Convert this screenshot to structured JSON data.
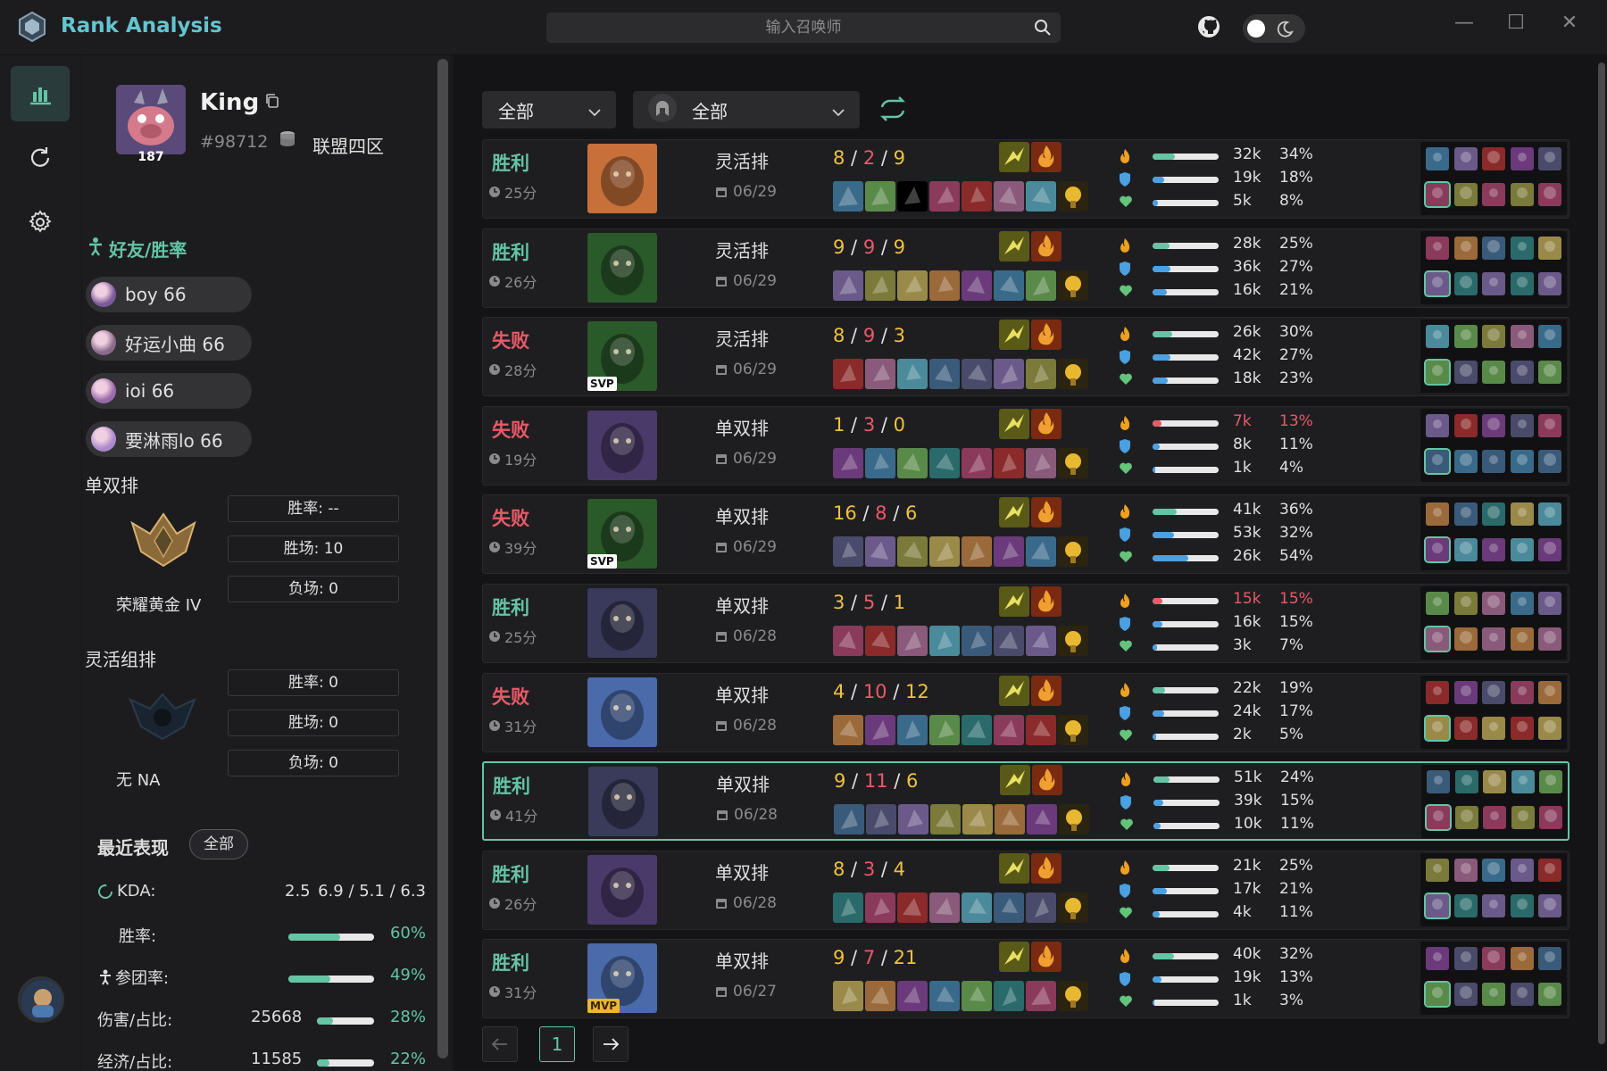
{
  "app": {
    "title": "Rank Analysis"
  },
  "search": {
    "placeholder": "输入召唤师"
  },
  "profile": {
    "name": "King",
    "tag": "#98712",
    "server": "联盟四区",
    "level": "187"
  },
  "friends": {
    "title": "好友/胜率",
    "items": [
      {
        "name": "boy 66",
        "color": "#7a5a9a"
      },
      {
        "name": "好运小曲 66",
        "color": "#8a6a8a"
      },
      {
        "name": "ioi 66",
        "color": "#9a6aaa"
      },
      {
        "name": "要淋雨lo 66",
        "color": "#aa8acc"
      }
    ]
  },
  "ranks": [
    {
      "title": "单双排",
      "winrate": "胜率: --",
      "wins": "胜场: 10",
      "losses": "负场: 0",
      "tier": "荣耀黄金 IV"
    },
    {
      "title": "灵活组排",
      "winrate": "胜率: 0",
      "wins": "胜场: 0",
      "losses": "负场: 0",
      "tier": "无 NA"
    }
  ],
  "recent": {
    "title": "最近表现",
    "filter": "全部",
    "kda_label": "KDA:",
    "kda_value": "2.5",
    "kda_detail": "6.9 / 5.1 / 6.3",
    "winrate_label": "胜率:",
    "winrate_pct": "60%",
    "winrate_value": 0.6,
    "teamfight_label": "参团率:",
    "teamfight_pct": "49%",
    "teamfight_value": 0.49,
    "damage_label": "伤害/占比:",
    "damage_value": "25668",
    "damage_pct": "28%",
    "damage_ratio": 0.28,
    "gold_label": "经济/占比:",
    "gold_value": "11585",
    "gold_pct": "22%",
    "gold_ratio": 0.22
  },
  "filters": {
    "mode": "全部",
    "champion": "全部"
  },
  "matches": [
    {
      "result": "胜利",
      "win": true,
      "duration": "25分",
      "queue": "灵活排",
      "date": "06/29",
      "k": "8",
      "d": "2",
      "a": "9",
      "badge": "",
      "champ": "#c8703a",
      "dmg": "32k",
      "dmg_pct": "34%",
      "dmg_r": 0.34,
      "tank": "19k",
      "tank_pct": "18%",
      "tank_r": 0.18,
      "heal": "5k",
      "heal_pct": "8%",
      "heal_r": 0.08,
      "selected": false
    },
    {
      "result": "胜利",
      "win": true,
      "duration": "26分",
      "queue": "灵活排",
      "date": "06/29",
      "k": "9",
      "d": "9",
      "a": "9",
      "badge": "",
      "champ": "#2a5a2a",
      "dmg": "28k",
      "dmg_pct": "25%",
      "dmg_r": 0.25,
      "tank": "36k",
      "tank_pct": "27%",
      "tank_r": 0.27,
      "heal": "16k",
      "heal_pct": "21%",
      "heal_r": 0.21,
      "selected": false
    },
    {
      "result": "失败",
      "win": false,
      "duration": "28分",
      "queue": "灵活排",
      "date": "06/29",
      "k": "8",
      "d": "9",
      "a": "3",
      "badge": "SVP",
      "champ": "#2a5a2a",
      "dmg": "26k",
      "dmg_pct": "30%",
      "dmg_r": 0.3,
      "tank": "42k",
      "tank_pct": "27%",
      "tank_r": 0.27,
      "heal": "18k",
      "heal_pct": "23%",
      "heal_r": 0.23,
      "selected": false
    },
    {
      "result": "失败",
      "win": false,
      "duration": "19分",
      "queue": "单双排",
      "date": "06/29",
      "k": "1",
      "d": "3",
      "a": "0",
      "badge": "",
      "champ": "#4a3a6a",
      "dmg": "7k",
      "dmg_pct": "13%",
      "dmg_r": 0.13,
      "dmg_low": true,
      "tank": "8k",
      "tank_pct": "11%",
      "tank_r": 0.11,
      "heal": "1k",
      "heal_pct": "4%",
      "heal_r": 0.04,
      "selected": false
    },
    {
      "result": "失败",
      "win": false,
      "duration": "39分",
      "queue": "单双排",
      "date": "06/29",
      "k": "16",
      "d": "8",
      "a": "6",
      "badge": "SVP",
      "champ": "#2a5a2a",
      "dmg": "41k",
      "dmg_pct": "36%",
      "dmg_r": 0.36,
      "tank": "53k",
      "tank_pct": "32%",
      "tank_r": 0.32,
      "heal": "26k",
      "heal_pct": "54%",
      "heal_r": 0.54,
      "selected": false
    },
    {
      "result": "胜利",
      "win": true,
      "duration": "25分",
      "queue": "单双排",
      "date": "06/28",
      "k": "3",
      "d": "5",
      "a": "1",
      "badge": "",
      "champ": "#3a3a5a",
      "dmg": "15k",
      "dmg_pct": "15%",
      "dmg_r": 0.15,
      "dmg_low": true,
      "tank": "16k",
      "tank_pct": "15%",
      "tank_r": 0.15,
      "heal": "3k",
      "heal_pct": "7%",
      "heal_r": 0.07,
      "selected": false
    },
    {
      "result": "失败",
      "win": false,
      "duration": "31分",
      "queue": "单双排",
      "date": "06/28",
      "k": "4",
      "d": "10",
      "a": "12",
      "badge": "",
      "champ": "#4a6aaa",
      "dmg": "22k",
      "dmg_pct": "19%",
      "dmg_r": 0.19,
      "tank": "24k",
      "tank_pct": "17%",
      "tank_r": 0.17,
      "heal": "2k",
      "heal_pct": "5%",
      "heal_r": 0.05,
      "selected": false
    },
    {
      "result": "胜利",
      "win": true,
      "duration": "41分",
      "queue": "单双排",
      "date": "06/28",
      "k": "9",
      "d": "11",
      "a": "6",
      "badge": "",
      "champ": "#3a3a5a",
      "dmg": "51k",
      "dmg_pct": "24%",
      "dmg_r": 0.24,
      "tank": "39k",
      "tank_pct": "15%",
      "tank_r": 0.15,
      "heal": "10k",
      "heal_pct": "11%",
      "heal_r": 0.11,
      "selected": true
    },
    {
      "result": "胜利",
      "win": true,
      "duration": "26分",
      "queue": "单双排",
      "date": "06/28",
      "k": "8",
      "d": "3",
      "a": "4",
      "badge": "",
      "champ": "#4a3a6a",
      "dmg": "21k",
      "dmg_pct": "25%",
      "dmg_r": 0.25,
      "tank": "17k",
      "tank_pct": "21%",
      "tank_r": 0.21,
      "heal": "4k",
      "heal_pct": "11%",
      "heal_r": 0.11,
      "selected": false
    },
    {
      "result": "胜利",
      "win": true,
      "duration": "31分",
      "queue": "单双排",
      "date": "06/27",
      "k": "9",
      "d": "7",
      "a": "21",
      "badge": "MVP",
      "champ": "#4a6aaa",
      "dmg": "40k",
      "dmg_pct": "32%",
      "dmg_r": 0.32,
      "tank": "19k",
      "tank_pct": "13%",
      "tank_r": 0.13,
      "heal": "1k",
      "heal_pct": "3%",
      "heal_r": 0.03,
      "selected": false
    }
  ],
  "pager": {
    "current": "1"
  },
  "colors": {
    "accent": "#64c4a4",
    "win": "#64c4a4",
    "loss": "#e85a68",
    "kda": "#f0c040",
    "dmg_bar": "#64c4a4",
    "tank_bar": "#4aa0e0",
    "heal_bar": "#4aa0e0"
  }
}
